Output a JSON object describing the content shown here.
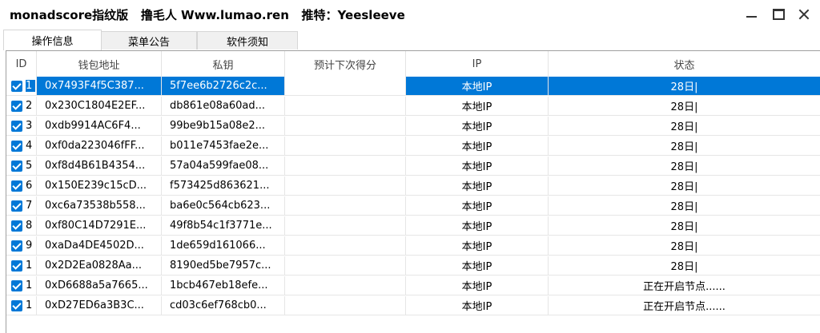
{
  "window": {
    "title": "monadscore指纹版   撸毛人 Www.lumao.ren   推特：Yeesleeve"
  },
  "tabs": [
    {
      "label": "操作信息",
      "active": true
    },
    {
      "label": "菜单公告",
      "active": false
    },
    {
      "label": "软件须知",
      "active": false
    }
  ],
  "columns": [
    "ID",
    "钱包地址",
    "私钥",
    "预计下次得分",
    "IP",
    "状态"
  ],
  "rows": [
    {
      "checked": true,
      "id": "1",
      "wallet": "0x7493F4f5C387...",
      "key": "5f7ee6b2726c2c...",
      "score": "",
      "ip": "本地IP",
      "status": "28日|",
      "selected": true
    },
    {
      "checked": true,
      "id": "2",
      "wallet": "0x230C1804E2EF...",
      "key": "db861e08a60ad...",
      "score": "",
      "ip": "本地IP",
      "status": "28日|"
    },
    {
      "checked": true,
      "id": "3",
      "wallet": "0xdb9914AC6F4...",
      "key": "99be9b15a08e2...",
      "score": "",
      "ip": "本地IP",
      "status": "28日|"
    },
    {
      "checked": true,
      "id": "4",
      "wallet": "0xf0da223046fFF...",
      "key": "b011e7453fae2e...",
      "score": "",
      "ip": "本地IP",
      "status": "28日|"
    },
    {
      "checked": true,
      "id": "5",
      "wallet": "0xf8d4B61B4354...",
      "key": "57a04a599fae08...",
      "score": "",
      "ip": "本地IP",
      "status": "28日|"
    },
    {
      "checked": true,
      "id": "6",
      "wallet": "0x150E239c15cD...",
      "key": "f573425d863621...",
      "score": "",
      "ip": "本地IP",
      "status": "28日|"
    },
    {
      "checked": true,
      "id": "7",
      "wallet": "0xc6a73538b558...",
      "key": "ba6e0c564cb623...",
      "score": "",
      "ip": "本地IP",
      "status": "28日|"
    },
    {
      "checked": true,
      "id": "8",
      "wallet": "0xf80C14D7291E...",
      "key": "49f8b54c1f3771e...",
      "score": "",
      "ip": "本地IP",
      "status": "28日|"
    },
    {
      "checked": true,
      "id": "9",
      "wallet": "0xaDa4DE4502D...",
      "key": "1de659d161066...",
      "score": "",
      "ip": "本地IP",
      "status": "28日|"
    },
    {
      "checked": true,
      "id": "1",
      "wallet": "0x2D2Ea0828Aa...",
      "key": "8190ed5be7957c...",
      "score": "",
      "ip": "本地IP",
      "status": "28日|"
    },
    {
      "checked": true,
      "id": "1",
      "wallet": "0xD6688a5a7665...",
      "key": "1bcb467eb18efe...",
      "score": "",
      "ip": "本地IP",
      "status": "正在开启节点......"
    },
    {
      "checked": true,
      "id": "1",
      "wallet": "0xD27ED6a3B3C...",
      "key": "cd03c6ef768cb0...",
      "score": "",
      "ip": "本地IP",
      "status": "正在开启节点......"
    }
  ],
  "colors": {
    "selection": "#0078d7",
    "checkbox": "#0078d7"
  }
}
